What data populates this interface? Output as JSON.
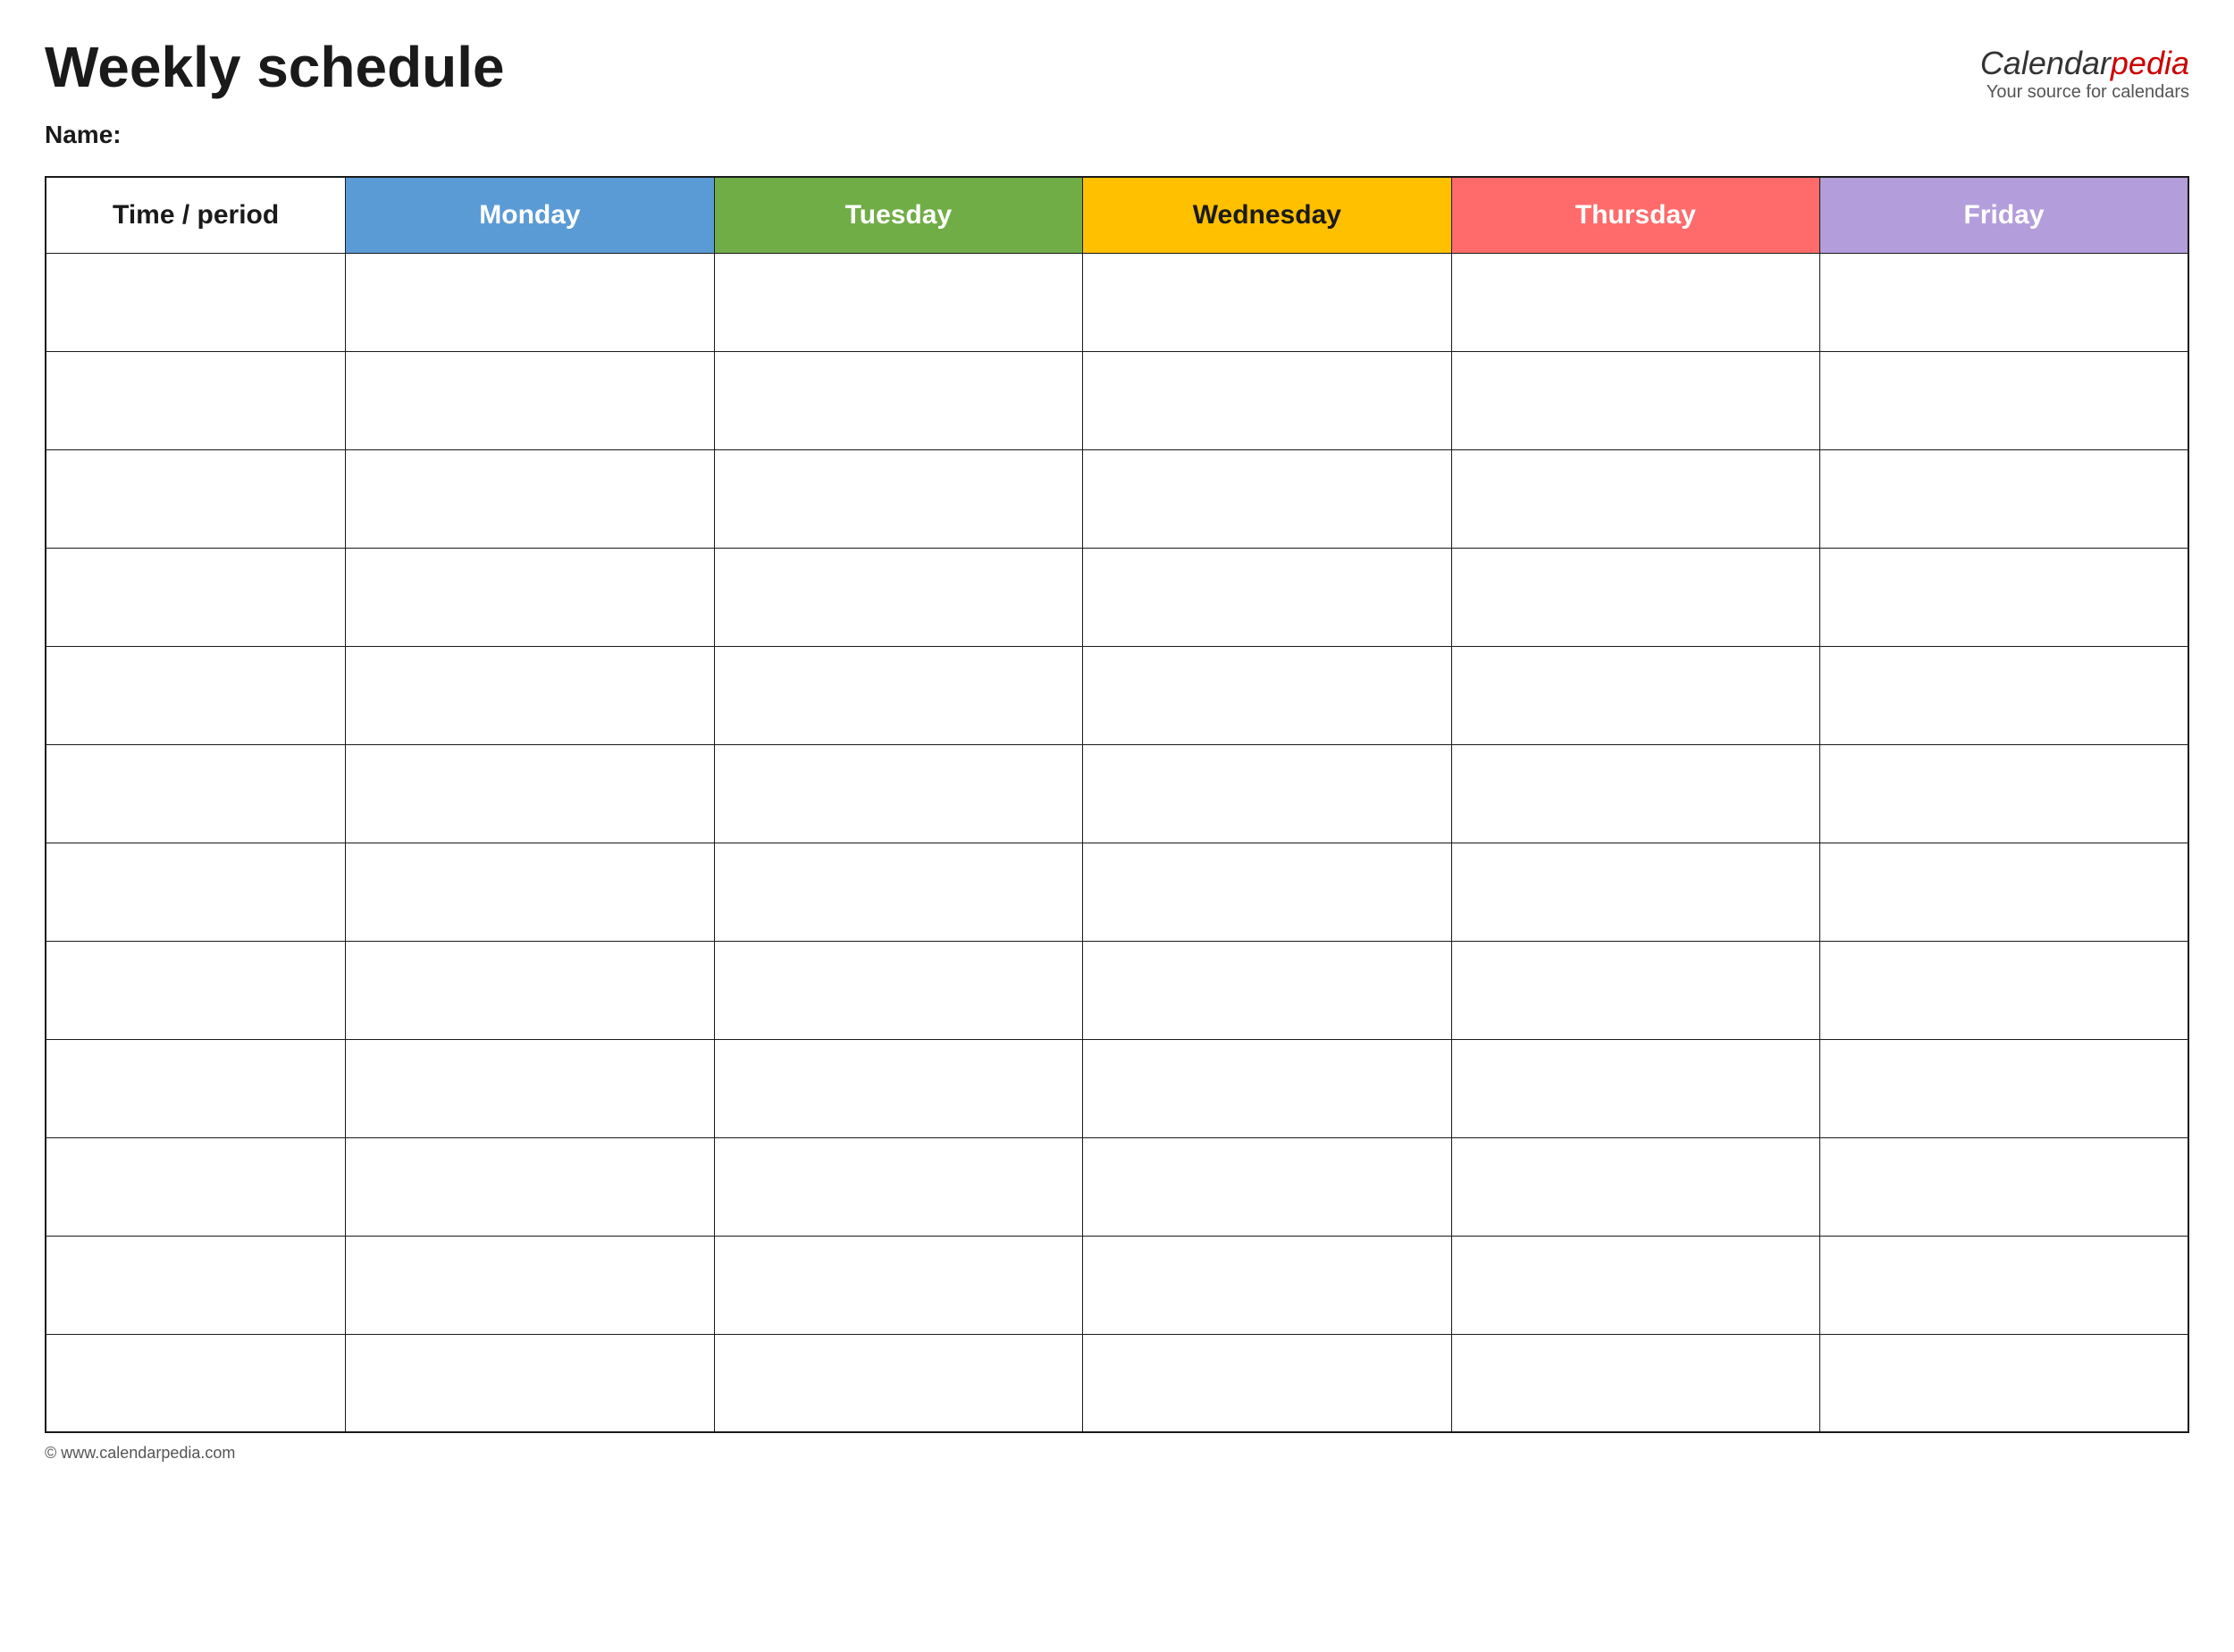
{
  "page": {
    "title": "Weekly schedule",
    "name_label": "Name:",
    "logo": {
      "calendar": "Calendar",
      "pedia": "pedia",
      "tagline": "Your source for calendars"
    },
    "footer": "© www.calendarpedia.com"
  },
  "table": {
    "headers": [
      {
        "id": "time",
        "label": "Time / period",
        "class": "col-time"
      },
      {
        "id": "monday",
        "label": "Monday",
        "class": "col-monday"
      },
      {
        "id": "tuesday",
        "label": "Tuesday",
        "class": "col-tuesday"
      },
      {
        "id": "wednesday",
        "label": "Wednesday",
        "class": "col-wednesday"
      },
      {
        "id": "thursday",
        "label": "Thursday",
        "class": "col-thursday"
      },
      {
        "id": "friday",
        "label": "Friday",
        "class": "col-friday"
      }
    ],
    "row_count": 12
  }
}
